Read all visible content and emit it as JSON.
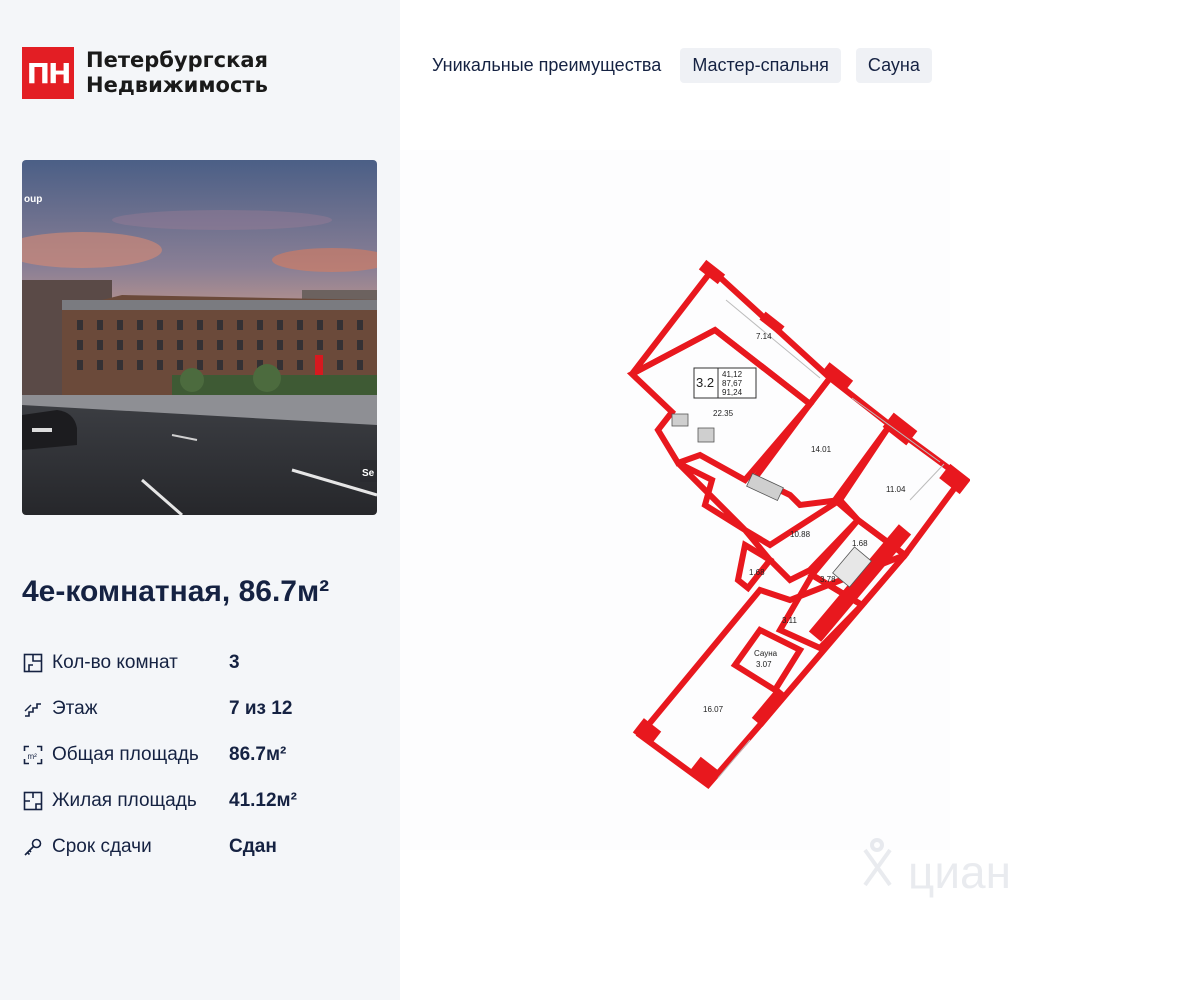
{
  "brand": {
    "logo_mark": "ПН",
    "line1": "Петербургская",
    "line2": "Недвижимость",
    "accent": "#e31e24"
  },
  "photo": {
    "overlay_text_left": "oup",
    "overlay_text_right": "Se"
  },
  "listing": {
    "title": "4е-комнатная, 86.7м²"
  },
  "facts": [
    {
      "icon": "rooms-icon",
      "label": "Кол-во комнат",
      "value": "3"
    },
    {
      "icon": "stairs-icon",
      "label": "Этаж",
      "value": "7 из 12"
    },
    {
      "icon": "area-icon",
      "label": "Общая площадь",
      "value": "86.7м²"
    },
    {
      "icon": "living-area-icon",
      "label": "Жилая площадь",
      "value": "41.12м²"
    },
    {
      "icon": "key-icon",
      "label": "Срок сдачи",
      "value": "Сдан"
    }
  ],
  "advantages": {
    "heading": "Уникальные преимущества",
    "tags": [
      "Мастер-спальня",
      "Сауна"
    ]
  },
  "floorplan": {
    "unit": "3.2",
    "areas": [
      "41,12",
      "87,67",
      "91,24"
    ],
    "rooms": {
      "balcony_top": "7.14",
      "kitchen": "22.35",
      "bedroom1": "14.01",
      "bedroom2": "11.04",
      "hall": "10.88",
      "closet": "1.68",
      "wc": "1.68",
      "bath": "3.78",
      "shower": "3.11",
      "sauna_label": "Сауна",
      "sauna": "3.07",
      "bedroom3": "16.07"
    },
    "wall_color": "#e8181e"
  },
  "watermark": "циан"
}
